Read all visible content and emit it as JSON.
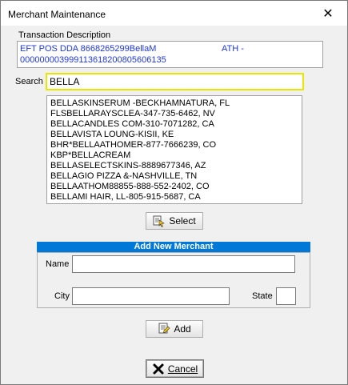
{
  "window": {
    "title": "Merchant Maintenance",
    "close_glyph": "✕"
  },
  "transaction": {
    "label": "Transaction Description",
    "line1_left": "EFT POS DDA 8668265299BellaM",
    "line1_right": "ATH -",
    "line2": "000000003999113618200805606135"
  },
  "search": {
    "label": "Search",
    "value": "BELLA"
  },
  "results": [
    "BELLASKINSERUM -BECKHAMNATURA, FL",
    "FLSBELLARAYSCLEA-347-735-6462, NV",
    "BELLACANDLES COM-310-7071282, CA",
    "BELLAVISTA LOUNG-KISII, KE",
    "BHR*BELLAATHOMER-877-7666239, CO",
    "KBP*BELLACREAM",
    "BELLASELECTSKINS-8889677346, AZ",
    "BELLAGIO PIZZA &-NASHVILLE, TN",
    "BELLAATHOM88855-888-552-2402, CO",
    "BELLAMI HAIR, LL-805-915-5687, CA"
  ],
  "buttons": {
    "select": "Select",
    "add": "Add",
    "cancel": "Cancel"
  },
  "add_merchant": {
    "header": "Add New Merchant",
    "name_label": "Name",
    "name_value": "",
    "city_label": "City",
    "city_value": "",
    "state_label": "State",
    "state_value": ""
  },
  "icons": {
    "select": "select-icon",
    "add": "add-icon",
    "cancel": "cancel-x-icon"
  },
  "colors": {
    "accent": "#0078d7",
    "description_text": "#1f38d6",
    "search_border": "#e6e600",
    "cancel_icon": "#000000"
  }
}
